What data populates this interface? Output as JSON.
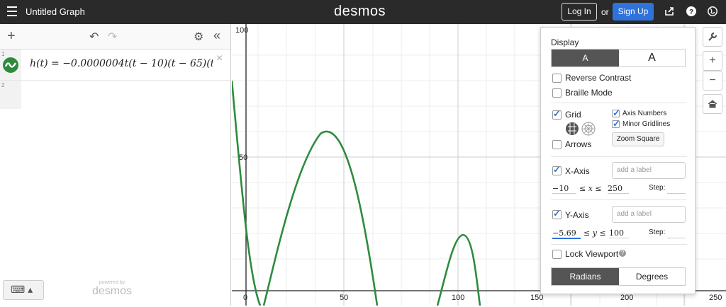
{
  "header": {
    "title": "Untitled Graph",
    "logo": "desmos",
    "login_label": "Log In",
    "or_label": "or",
    "signup_label": "Sign Up",
    "icons": [
      "menu-icon",
      "share-icon",
      "help-icon",
      "globe-icon"
    ]
  },
  "expressions": {
    "toolbar": {
      "add_label": "+",
      "undo_label": "↶",
      "redo_label": "↷",
      "settings_label": "⚙",
      "collapse_label": "«"
    },
    "rows": [
      {
        "index": "1",
        "formula": "h(t) = −0.0000004t(t − 10)(t − 65)(t",
        "close_label": "×"
      },
      {
        "index": "2"
      }
    ],
    "keyboard_label": "⌨ ▴",
    "powered_small": "powered by",
    "powered_big": "desmos"
  },
  "graph_settings": {
    "display_label": "Display",
    "display_modes": [
      "A",
      "A"
    ],
    "reverse_contrast_label": "Reverse Contrast",
    "braille_mode_label": "Braille Mode",
    "grid_label": "Grid",
    "axis_numbers_label": "Axis Numbers",
    "minor_gridlines_label": "Minor Gridlines",
    "zoom_square_label": "Zoom Square",
    "arrows_label": "Arrows",
    "x_axis": {
      "label": "X-Axis",
      "label_placeholder": "add a label",
      "min": "−10",
      "max": "250",
      "var": "≤ x ≤",
      "step_label": "Step:"
    },
    "y_axis": {
      "label": "Y-Axis",
      "label_placeholder": "add a label",
      "min": "−5.69",
      "max": "100",
      "var": "≤ y ≤",
      "step_label": "Step:"
    },
    "lock_viewport_label": "Lock Viewport",
    "angle_modes": [
      "Radians",
      "Degrees"
    ],
    "states": {
      "reverse_contrast": false,
      "braille_mode": false,
      "grid": true,
      "axis_numbers": true,
      "minor_gridlines": true,
      "arrows": false,
      "x_axis": true,
      "y_axis": true,
      "lock_viewport": false,
      "angle_mode": "Radians"
    }
  },
  "side_buttons": [
    "wrench-icon",
    "zoom-in-icon",
    "zoom-out-icon",
    "home-icon"
  ],
  "side_labels": {
    "zoom_in": "+",
    "zoom_out": "−"
  },
  "axis": {
    "x_ticks": [
      "0",
      "50",
      "100",
      "150",
      "200",
      "250"
    ],
    "y_ticks": [
      "100",
      "50"
    ]
  },
  "colors": {
    "curve": "#2e8b3e",
    "accent": "#2f72dc",
    "header_bg": "#2a2a2a"
  }
}
